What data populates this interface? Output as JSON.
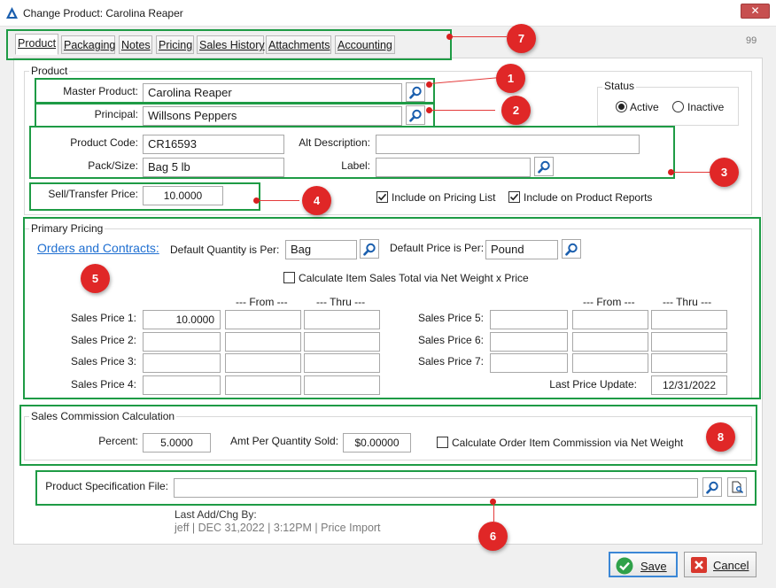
{
  "window": {
    "title": "Change Product: Carolina Reaper",
    "close_glyph": "✕"
  },
  "tabs": [
    {
      "label": "Product"
    },
    {
      "label": "Packaging"
    },
    {
      "label": "Notes"
    },
    {
      "label": "Pricing"
    },
    {
      "label": "Sales History"
    },
    {
      "label": "Attachments"
    },
    {
      "label": "Accounting"
    }
  ],
  "record_counter": "99",
  "product_group": {
    "title": "Product",
    "master_product_label": "Master Product:",
    "master_product_value": "Carolina Reaper",
    "principal_label": "Principal:",
    "principal_value": "Willsons Peppers",
    "product_code_label": "Product Code:",
    "product_code_value": "CR16593",
    "pack_size_label": "Pack/Size:",
    "pack_size_value": "Bag 5 lb",
    "alt_description_label": "Alt Description:",
    "alt_description_value": "",
    "label_label": "Label:",
    "label_value": "",
    "sell_transfer_price_label": "Sell/Transfer Price:",
    "sell_transfer_price_value": "10.0000",
    "include_pricing_list_label": "Include on Pricing List",
    "include_product_reports_label": "Include on Product Reports"
  },
  "status": {
    "title": "Status",
    "active_label": "Active",
    "inactive_label": "Inactive",
    "selected": "Active"
  },
  "primary_pricing": {
    "title": "Primary Pricing",
    "orders_link": "Orders and Contracts:",
    "default_qty_label": "Default Quantity is Per:",
    "default_qty_value": "Bag",
    "default_price_label": "Default Price is Per:",
    "default_price_value": "Pound",
    "calc_net_weight_label": "Calculate Item Sales Total via Net Weight  x Price",
    "from_header": "--- From ---",
    "thru_header": "--- Thru ---",
    "left_prices": [
      {
        "label": "Sales Price 1:",
        "value": "10.0000",
        "from": "",
        "thru": ""
      },
      {
        "label": "Sales Price 2:",
        "value": "",
        "from": "",
        "thru": ""
      },
      {
        "label": "Sales Price 3:",
        "value": "",
        "from": "",
        "thru": ""
      },
      {
        "label": "Sales Price 4:",
        "value": "",
        "from": "",
        "thru": ""
      }
    ],
    "right_prices": [
      {
        "label": "Sales Price 5:",
        "value": "",
        "from": "",
        "thru": ""
      },
      {
        "label": "Sales Price 6:",
        "value": "",
        "from": "",
        "thru": ""
      },
      {
        "label": "Sales Price 7:",
        "value": "",
        "from": "",
        "thru": ""
      }
    ],
    "last_price_update_label": "Last Price Update:",
    "last_price_update_value": "12/31/2022"
  },
  "commission": {
    "title": "Sales Commission Calculation",
    "percent_label": "Percent:",
    "percent_value": "5.0000",
    "amt_label": "Amt Per Quantity Sold:",
    "amt_value": "$0.00000",
    "calc_net_weight_label": "Calculate Order Item Commission via Net Weight"
  },
  "spec_file": {
    "label": "Product Specification File:",
    "value": ""
  },
  "last_change": {
    "label": "Last Add/Chg By:",
    "value": "jeff | DEC 31,2022 |  3:12PM | Price Import"
  },
  "buttons": {
    "save": "Save",
    "cancel": "Cancel"
  },
  "annotations": [
    "1",
    "2",
    "3",
    "4",
    "5",
    "6",
    "7",
    "8"
  ],
  "colors": {
    "highlight": "#1e9b45",
    "marker": "#e02727",
    "link": "#1f6fd1",
    "save_icon": "#2fa14a",
    "cancel_icon": "#d8372d"
  },
  "icons": {
    "app": "app-logo-icon",
    "search": "magnifier-icon",
    "file_browse": "file-search-icon",
    "save": "checkmark-icon",
    "cancel": "x-icon"
  }
}
